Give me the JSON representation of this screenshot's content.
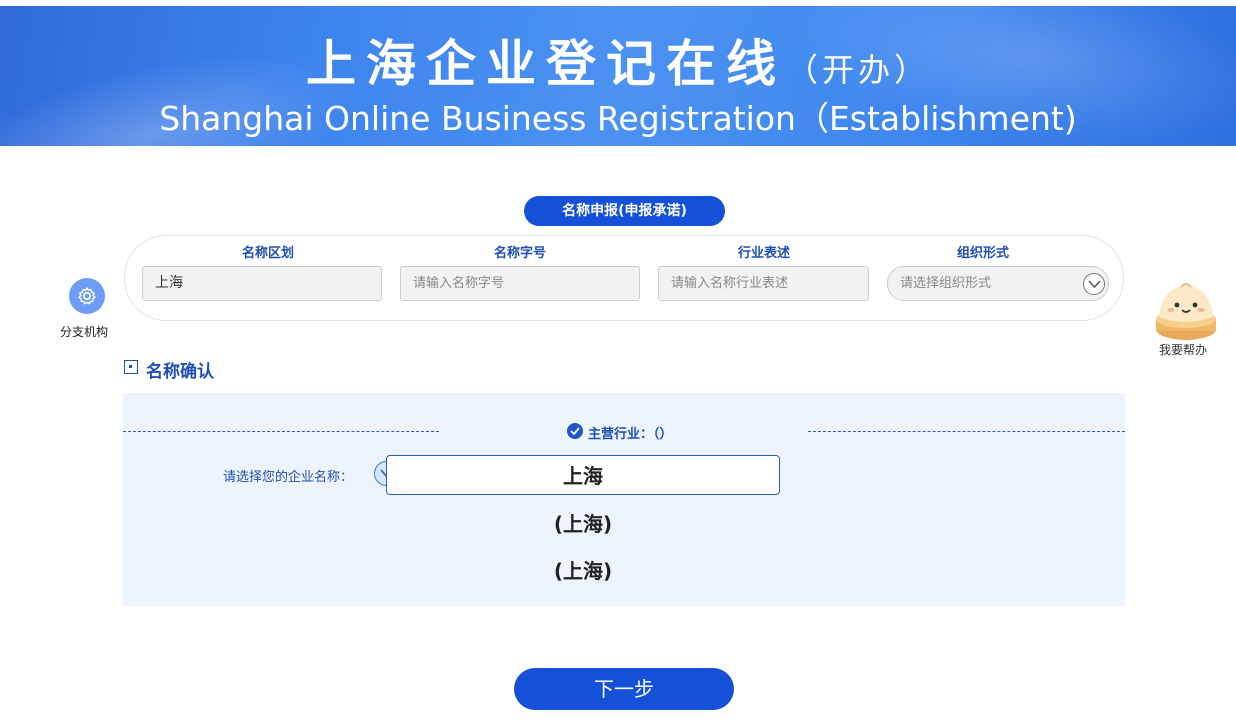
{
  "header": {
    "title_cn": "上海企业登记在线",
    "title_cn_suffix": "（开办）",
    "title_en": "Shanghai Online Business Registration（Establishment)"
  },
  "name_declaration": {
    "section_label": "名称申报(申报承诺)",
    "fields": [
      {
        "label": "名称区划",
        "value": "上海",
        "placeholder": ""
      },
      {
        "label": "名称字号",
        "value": "",
        "placeholder": "请输入名称字号"
      },
      {
        "label": "行业表述",
        "value": "",
        "placeholder": "请输入名称行业表述"
      },
      {
        "label": "组织形式",
        "value": "",
        "placeholder": "请选择组织形式"
      }
    ]
  },
  "sidebar": {
    "branch_label": "分支机构",
    "helper_label": "我要帮办"
  },
  "name_confirm": {
    "title": "名称确认",
    "industry_label": "主营行业：（）",
    "choose_label": "请选择您的企业名称：",
    "options": [
      "上海",
      "(上海)",
      "(上海)"
    ]
  },
  "actions": {
    "next_label": "下一步"
  },
  "colors": {
    "primary": "#1450d8",
    "label_blue": "#1f4fb5",
    "panel_bg": "#eef4fc"
  }
}
